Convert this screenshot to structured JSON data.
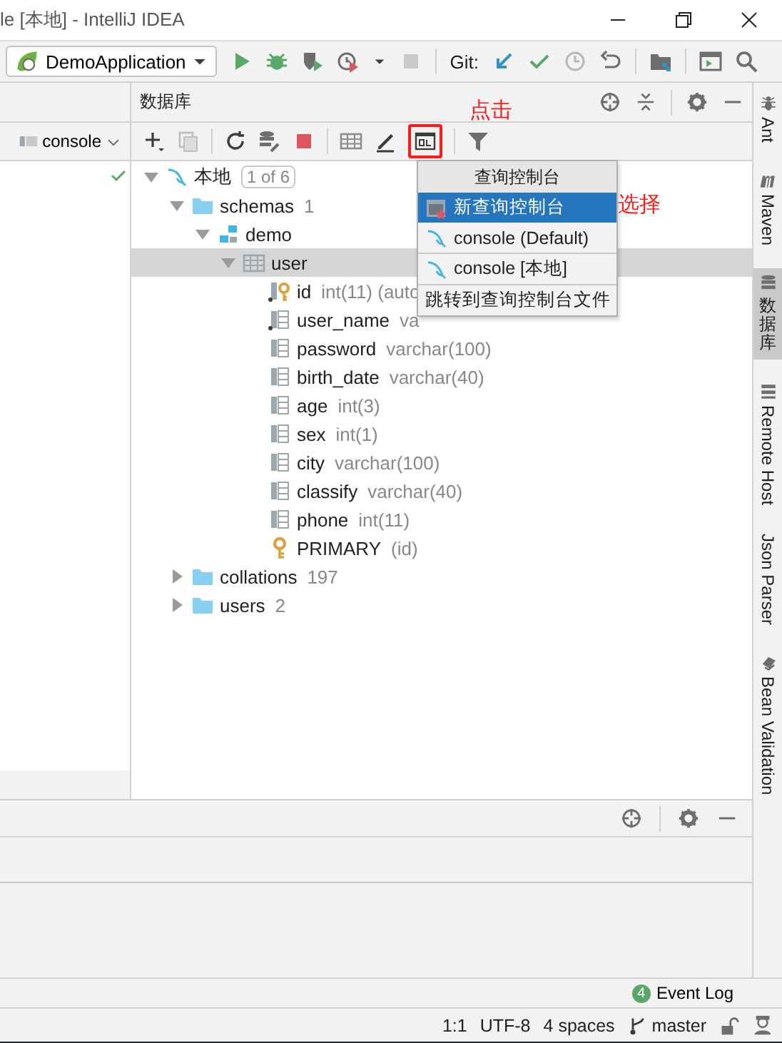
{
  "window": {
    "title": "le [本地] - IntelliJ IDEA"
  },
  "toolbar": {
    "run_config": "DemoApplication",
    "vcs_label": "Git:"
  },
  "left_panel": {
    "console_selector": "console"
  },
  "database_panel": {
    "title": "数据库",
    "query_button": {
      "highlighted": true
    },
    "tree": [
      {
        "kind": "datasource",
        "label": "本地",
        "badge": "1 of 6",
        "expanded": true,
        "selected": false,
        "children": [
          {
            "kind": "folder",
            "label": "schemas",
            "detail": "1",
            "expanded": true,
            "selected": false,
            "children": [
              {
                "kind": "schema",
                "label": "demo",
                "expanded": true,
                "selected": false,
                "children": [
                  {
                    "kind": "table",
                    "label": "user",
                    "expanded": true,
                    "selected": true,
                    "children": [
                      {
                        "kind": "key_column",
                        "label": "id",
                        "detail": "int(11) (auto",
                        "selected": false
                      },
                      {
                        "kind": "required_column",
                        "label": "user_name",
                        "detail": "va",
                        "selected": false
                      },
                      {
                        "kind": "column",
                        "label": "password",
                        "detail": "varchar(100)",
                        "selected": false
                      },
                      {
                        "kind": "column",
                        "label": "birth_date",
                        "detail": "varchar(40)",
                        "selected": false
                      },
                      {
                        "kind": "column",
                        "label": "age",
                        "detail": "int(3)",
                        "selected": false
                      },
                      {
                        "kind": "column",
                        "label": "sex",
                        "detail": "int(1)",
                        "selected": false
                      },
                      {
                        "kind": "column",
                        "label": "city",
                        "detail": "varchar(100)",
                        "selected": false
                      },
                      {
                        "kind": "column",
                        "label": "classify",
                        "detail": "varchar(40)",
                        "selected": false
                      },
                      {
                        "kind": "column",
                        "label": "phone",
                        "detail": "int(11)",
                        "selected": false
                      },
                      {
                        "kind": "index",
                        "label": "PRIMARY",
                        "detail": "(id)",
                        "selected": false
                      }
                    ]
                  }
                ]
              }
            ]
          },
          {
            "kind": "folder",
            "label": "collations",
            "detail": "197",
            "expanded": false,
            "selected": false
          },
          {
            "kind": "folder",
            "label": "users",
            "detail": "2",
            "expanded": false,
            "selected": false
          }
        ]
      }
    ],
    "popup": {
      "title": "查询控制台",
      "sections": [
        {
          "items": [
            {
              "kind": "new",
              "label": "新查询控制台",
              "selected": true
            },
            {
              "kind": "console",
              "label": "console (Default)",
              "selected": false
            }
          ]
        },
        {
          "items": [
            {
              "kind": "console",
              "label": "console [本地]",
              "selected": false
            }
          ]
        },
        {
          "items": [
            {
              "kind": "action",
              "label": "跳转到查询控制台文件",
              "selected": false
            }
          ]
        }
      ]
    }
  },
  "annotations": [
    {
      "text": "点击"
    },
    {
      "text": "选择"
    }
  ],
  "side_tabs": [
    {
      "kind": "ant",
      "label": "Ant",
      "upright": false,
      "selected": false
    },
    {
      "kind": "maven",
      "label": "Maven",
      "upright": false,
      "selected": false
    },
    {
      "kind": "database",
      "label": "数据库",
      "upright": true,
      "selected": true
    },
    {
      "kind": "remote",
      "label": "Remote Host",
      "upright": false,
      "selected": false
    },
    {
      "kind": "json",
      "label": "Json Parser",
      "upright": false,
      "selected": false
    },
    {
      "kind": "bean",
      "label": "Bean Validation",
      "upright": false,
      "selected": false
    }
  ],
  "event_log": {
    "count": "4",
    "label": "Event Log"
  },
  "status_bar": {
    "position": "1:1",
    "encoding": "UTF-8",
    "indent": "4 spaces",
    "branch": "master"
  }
}
